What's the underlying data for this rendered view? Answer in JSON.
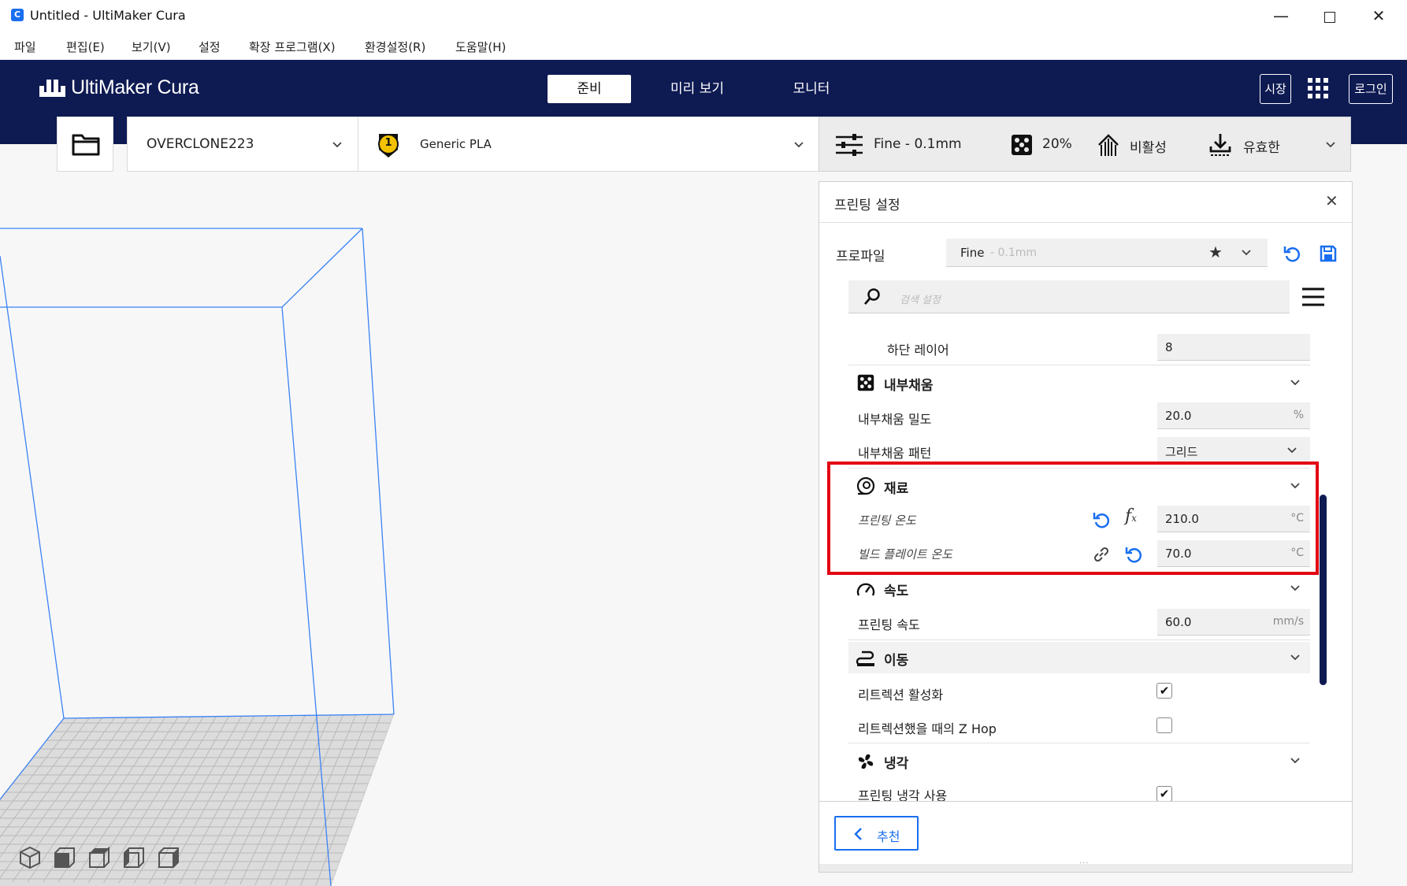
{
  "window": {
    "title": "Untitled - UltiMaker Cura",
    "app_icon_letter": "C"
  },
  "menu": [
    "파일",
    "편집(E)",
    "보기(V)",
    "설정",
    "확장 프로그램(X)",
    "환경설정(R)",
    "도움말(H)"
  ],
  "header": {
    "logo": "UltiMaker Cura",
    "tabs": [
      "준비",
      "미리 보기",
      "모니터"
    ],
    "active_tab": "준비",
    "marketplace": "시장",
    "login": "로그인"
  },
  "toolbar": {
    "printer": "OVERCLONE223",
    "extruder_number": "1",
    "material": "Generic PLA",
    "profile_summary": "Fine - 0.1mm",
    "infill_summary": "20%",
    "support_summary": "비활성",
    "adhesion_summary": "유효한"
  },
  "panel": {
    "title": "프린팅 설정",
    "profile_label": "프로파일",
    "profile_name": "Fine",
    "profile_sub": " - 0.1mm",
    "search_placeholder": "검색 설정",
    "bottom_layers_label": "하단 레이어",
    "bottom_layers_value": "8",
    "categories": {
      "infill": "내부채움",
      "material": "재료",
      "speed": "속도",
      "travel": "이동",
      "cooling": "냉각"
    },
    "infill_density_label": "내부채움 밀도",
    "infill_density_value": "20.0",
    "infill_density_unit": "%",
    "infill_pattern_label": "내부채움 패턴",
    "infill_pattern_value": "그리드",
    "print_temp_label": "프린팅 온도",
    "print_temp_value": "210.0",
    "print_temp_unit": "°C",
    "bed_temp_label": "빌드 플레이트 온도",
    "bed_temp_value": "70.0",
    "bed_temp_unit": "°C",
    "print_speed_label": "프린팅 속도",
    "print_speed_value": "60.0",
    "print_speed_unit": "mm/s",
    "retraction_label": "리트렉션 활성화",
    "retraction_checked": true,
    "zhop_label": "리트렉션했을 때의 Z Hop",
    "zhop_checked": false,
    "cooling_label": "프린팅 냉각 사용",
    "cooling_checked": true,
    "recommended_button": "추천",
    "highlight_color": "#e30613"
  },
  "colors": {
    "header_bg": "#0e1a52",
    "accent": "#196ef0"
  }
}
